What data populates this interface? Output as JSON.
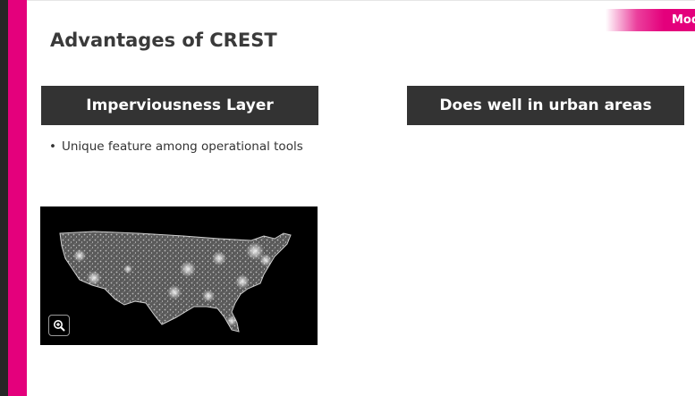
{
  "slide": {
    "module_tag": "Mode",
    "title": "Advantages of CREST",
    "left_header": "Imperviousness Layer",
    "right_header": "Does well in urban areas",
    "bullets": [
      "Unique feature among operational tools"
    ]
  },
  "icons": {
    "zoom": "zoom-in-icon"
  },
  "colors": {
    "accent": "#e4007c",
    "dark": "#262626",
    "header_bg": "#333333"
  }
}
